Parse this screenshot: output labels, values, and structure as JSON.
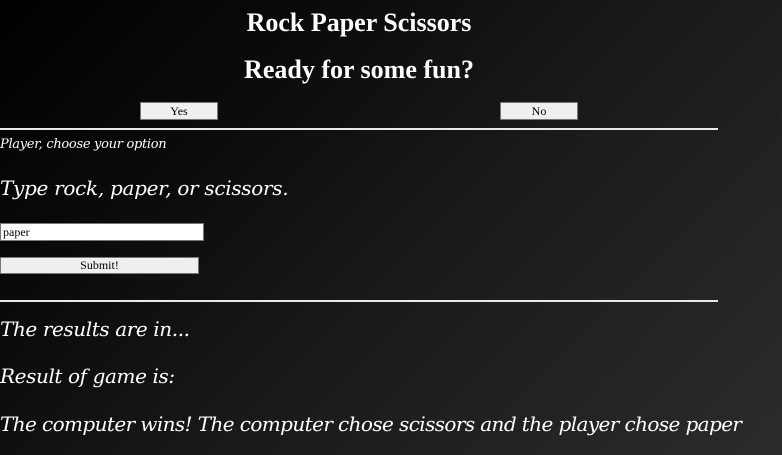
{
  "header": {
    "title": "Rock Paper Scissors",
    "subtitle": "Ready for some fun?"
  },
  "start": {
    "yes_label": "Yes",
    "no_label": "No"
  },
  "player": {
    "prompt": "Player, choose your option",
    "instruction": "Type rock, paper, or scissors.",
    "input_value": "paper",
    "submit_label": "Submit!"
  },
  "results": {
    "heading": "The results are in...",
    "label": "Result of game is:",
    "text": "The computer wins! The computer chose scissors and the player chose paper"
  }
}
